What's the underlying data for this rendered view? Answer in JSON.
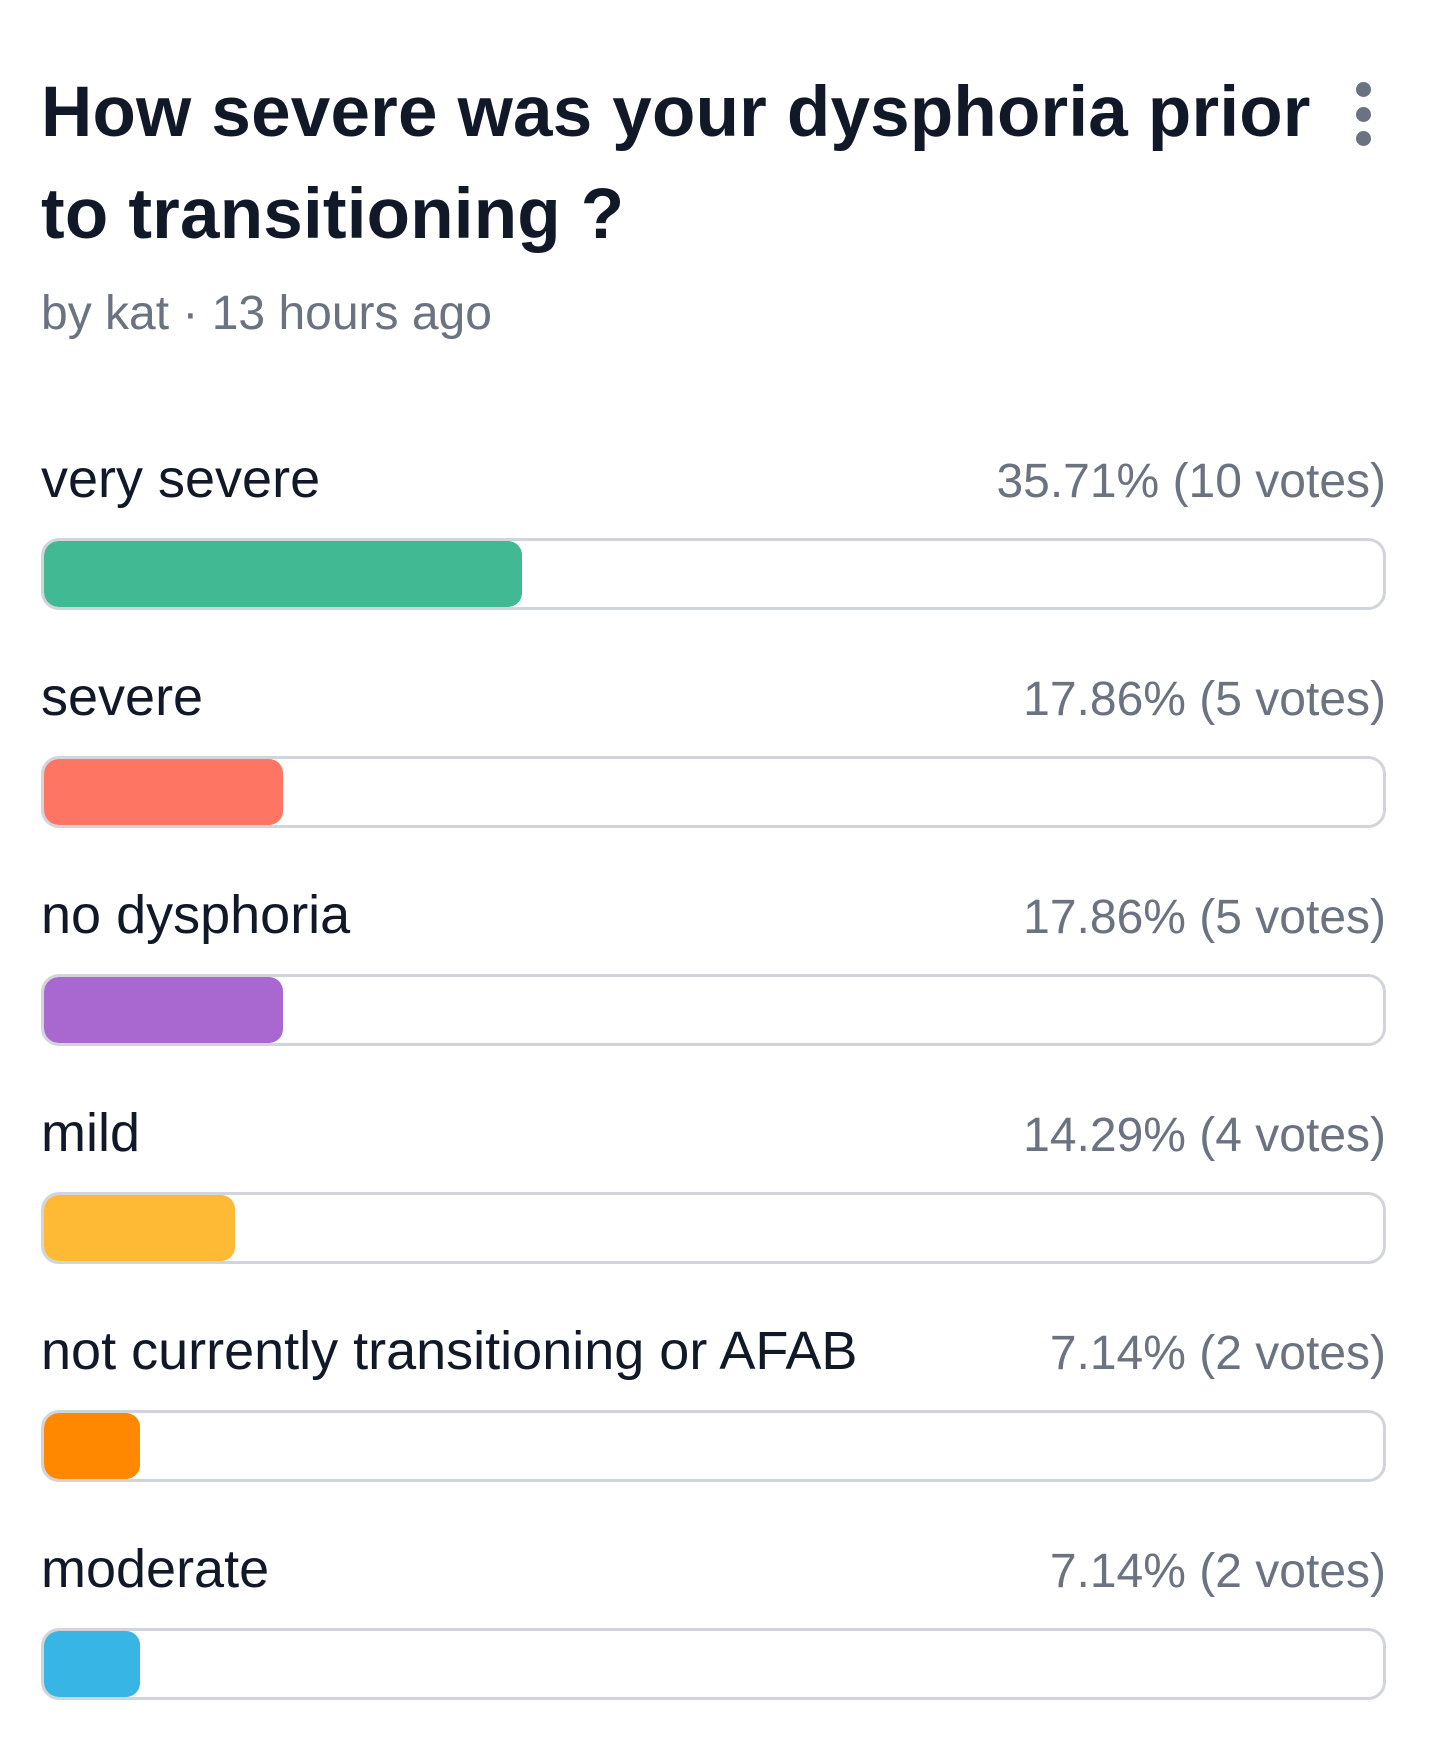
{
  "poll": {
    "title": "How severe was your dysphoria prior to transitioning ?",
    "meta": "by kat · 13 hours ago",
    "menu_icon": "more-vertical-icon",
    "options": [
      {
        "label": "very severe",
        "result": "35.71% (10 votes)",
        "percent": 35.71,
        "votes": 10,
        "color": "#41b993"
      },
      {
        "label": "severe",
        "result": "17.86% (5 votes)",
        "percent": 17.86,
        "votes": 5,
        "color": "#ff7563"
      },
      {
        "label": "no dysphoria",
        "result": "17.86% (5 votes)",
        "percent": 17.86,
        "votes": 5,
        "color": "#a968cf"
      },
      {
        "label": "mild",
        "result": "14.29% (4 votes)",
        "percent": 14.29,
        "votes": 4,
        "color": "#ffba35"
      },
      {
        "label": "not currently transitioning or AFAB",
        "result": "7.14% (2 votes)",
        "percent": 7.14,
        "votes": 2,
        "color": "#ff8800"
      },
      {
        "label": "moderate",
        "result": "7.14% (2 votes)",
        "percent": 7.14,
        "votes": 2,
        "color": "#37b6e6"
      }
    ]
  }
}
